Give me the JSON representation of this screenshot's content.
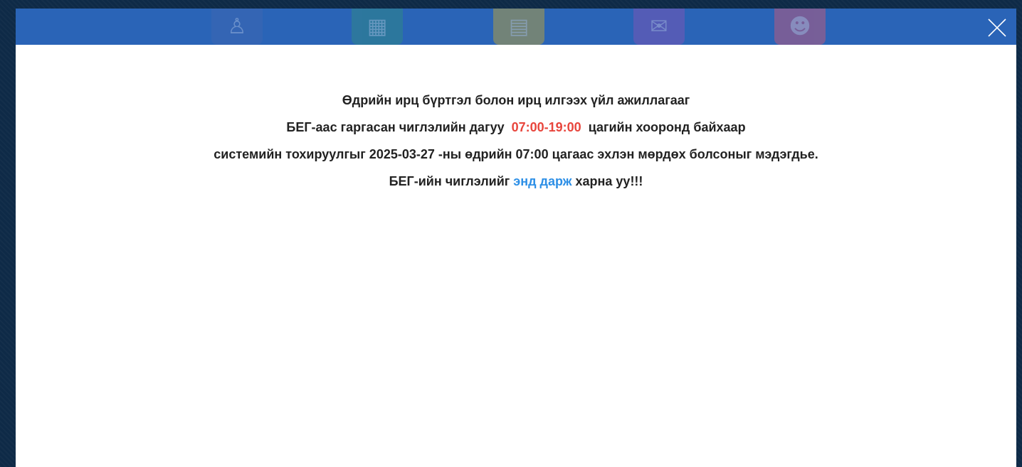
{
  "colors": {
    "header_bg": "#2a64b7",
    "hours_red": "#e8453c",
    "link_blue": "#2d8fe6",
    "text": "#222222"
  },
  "header": {
    "background_icons": [
      "student-icon",
      "grid-check-icon",
      "classroom-icon",
      "mail-icon",
      "people-add-icon"
    ],
    "close_icon": "close-icon"
  },
  "notice": {
    "line1": "Өдрийн ирц бүртгэл болон ирц илгээх үйл ажиллагааг",
    "line2_before": "БЕГ-аас гаргасан чиглэлийн дагуу",
    "line2_hours": "07:00-19:00",
    "line2_after": "цагийн хооронд байхаар",
    "line3": "системийн тохируулгыг 2025-03-27 -ны өдрийн 07:00 цагаас эхлэн мөрдөх болсоныг мэдэгдье.",
    "line4_before": "БЕГ-ийн чиглэлийг",
    "line4_link": "энд дарж",
    "line4_after": "харна уу!!!"
  }
}
